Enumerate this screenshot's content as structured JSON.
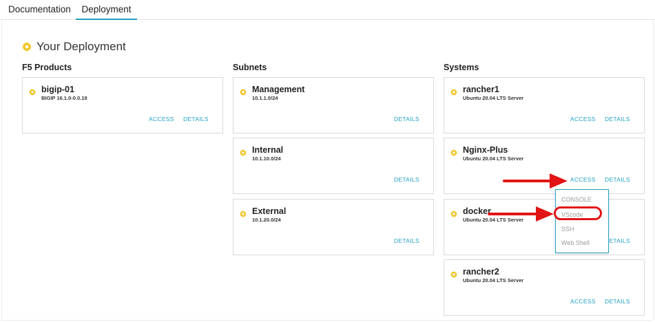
{
  "tabs": [
    {
      "label": "Documentation"
    },
    {
      "label": "Deployment"
    }
  ],
  "page": {
    "title": "Your Deployment"
  },
  "columns": {
    "f5": {
      "header": "F5 Products"
    },
    "subnets": {
      "header": "Subnets"
    },
    "systems": {
      "header": "Systems"
    }
  },
  "f5_products": [
    {
      "name": "bigip-01",
      "sub": "BIGIP 16.1.0-0.0.19",
      "access": "ACCESS",
      "details": "DETAILS"
    }
  ],
  "subnets": [
    {
      "name": "Management",
      "sub": "10.1.1.0/24",
      "details": "DETAILS"
    },
    {
      "name": "Internal",
      "sub": "10.1.10.0/24",
      "details": "DETAILS"
    },
    {
      "name": "External",
      "sub": "10.1.20.0/24",
      "details": "DETAILS"
    }
  ],
  "systems": [
    {
      "name": "rancher1",
      "sub": "Ubuntu 20.04 LTS Server",
      "access": "ACCESS",
      "details": "DETAILS"
    },
    {
      "name": "Nginx-Plus",
      "sub": "Ubuntu 20.04 LTS Server",
      "access": "ACCESS",
      "details": "DETAILS"
    },
    {
      "name": "docker",
      "sub": "Ubuntu 20.04 LTS Server",
      "details": "DETAILS"
    },
    {
      "name": "rancher2",
      "sub": "Ubuntu 20.04 LTS Server",
      "access": "ACCESS",
      "details": "DETAILS"
    }
  ],
  "access_menu": {
    "items": [
      {
        "label": "CONSOLE"
      },
      {
        "label": "VScode"
      },
      {
        "label": "SSH"
      },
      {
        "label": "Web Shell"
      }
    ]
  },
  "colors": {
    "accent": "#21a0c3",
    "gear": "#f2c41f",
    "annotation": "#e21414"
  },
  "icons": [
    "gear-icon",
    "arrow-icon"
  ]
}
